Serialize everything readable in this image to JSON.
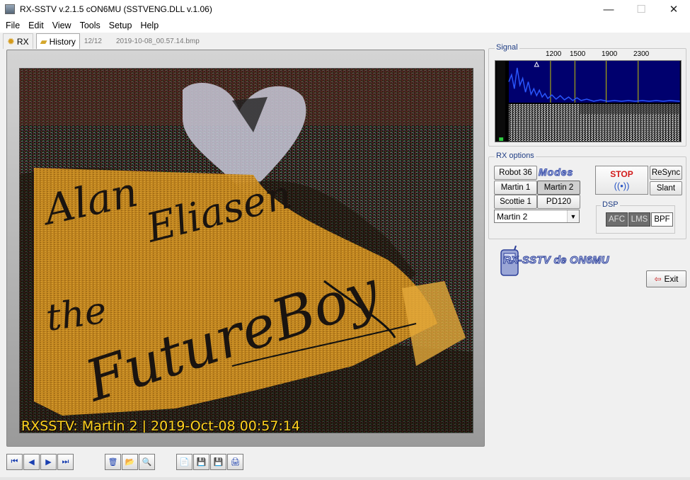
{
  "window": {
    "title": "RX-SSTV v.2.1.5 cON6MU (SSTVENG.DLL v.1.06)",
    "minimize": "—",
    "maximize": "☐",
    "close": "✕"
  },
  "menu": [
    "File",
    "Edit",
    "View",
    "Tools",
    "Setup",
    "Help"
  ],
  "tabs": {
    "rx_label": "RX",
    "history_label": "History",
    "counter": "12/12",
    "filename": "2019-10-08_00.57.14.bmp"
  },
  "image": {
    "caption": "RXSSTV: Martin 2 | 2019-Oct-08 00:57:14",
    "hand_line1": "Alan Eliasen",
    "hand_line2": "the",
    "hand_line3": "FutureBoy"
  },
  "signal": {
    "label": "Signal",
    "freqs": [
      "1200",
      "1500",
      "1900",
      "2300"
    ]
  },
  "rx_options": {
    "label": "RX options",
    "modes_logo": "Modes",
    "mode_buttons": [
      "Robot 36",
      "Martin 1",
      "Martin 2",
      "Scottie 1",
      "PD120"
    ],
    "selected_mode": "Martin 2",
    "stop_label": "STOP",
    "resync_label": "ReSync",
    "slant_label": "Slant",
    "dsp_label": "DSP",
    "afc_label": "AFC",
    "lms_label": "LMS",
    "bpf_label": "BPF"
  },
  "logo_text": "RX-SSTV de ON6MU",
  "exit_label": "Exit",
  "toolbar": {
    "first": "⏮",
    "prev": "◀",
    "next": "▶",
    "last": "⏭",
    "delete": "🗑",
    "open": "📂",
    "zoom": "🔍",
    "copy": "📄",
    "save": "💾",
    "save_as": "💾",
    "scan": "🖨"
  },
  "colors": {
    "accent": "#1f3d84",
    "stop": "#d21a1a",
    "caption": "#ffd21e",
    "spectrum_line": "#2a57ff",
    "marker": "#c9c900"
  }
}
